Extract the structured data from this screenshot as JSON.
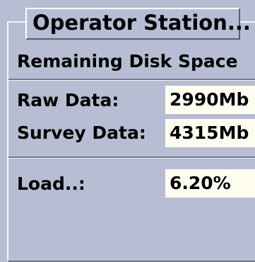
{
  "panel": {
    "title_button": "Operator Station...",
    "section_title": "Remaining Disk Space"
  },
  "disk": {
    "raw_label": "Raw Data:",
    "raw_value": "2990Mb",
    "survey_label": "Survey Data:",
    "survey_value": "4315Mb"
  },
  "load": {
    "label": "Load..:",
    "value": "6.20%"
  }
}
